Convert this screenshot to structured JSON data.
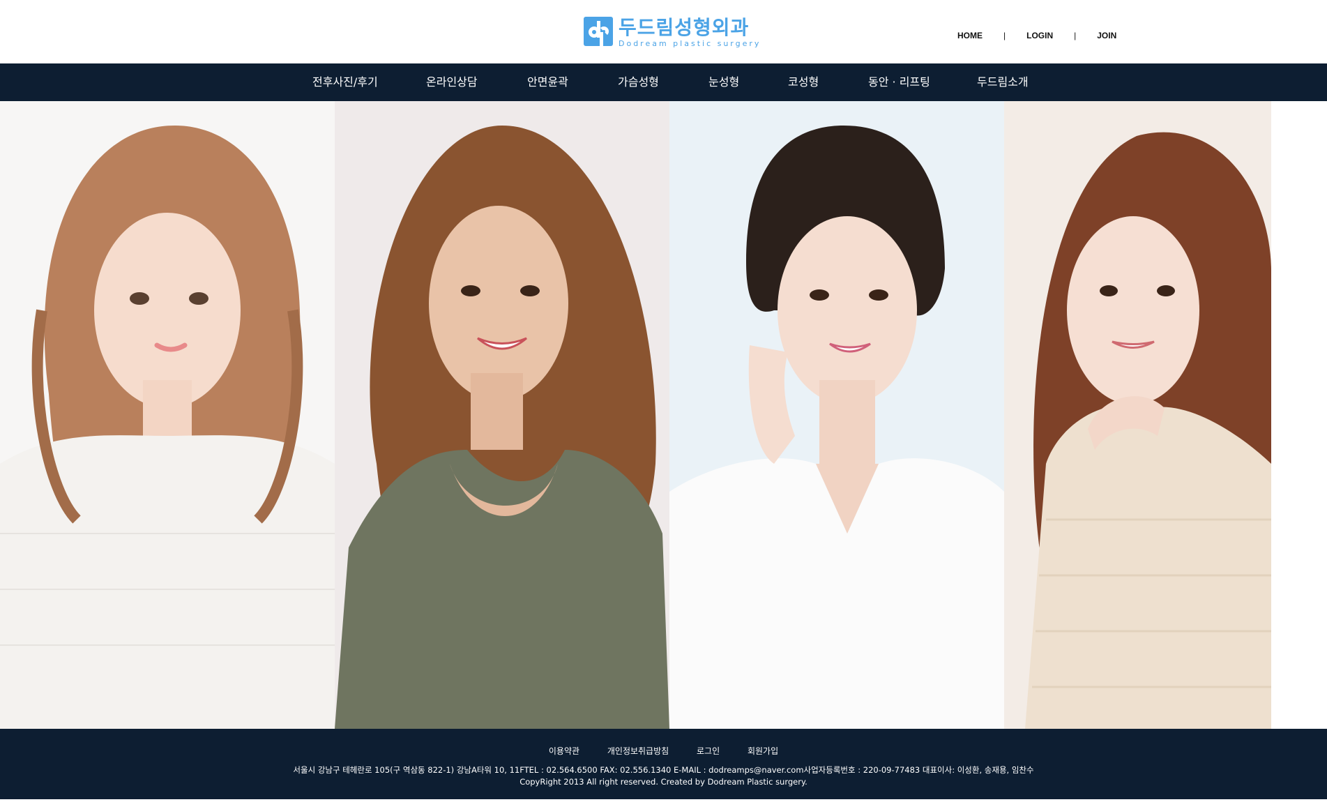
{
  "header": {
    "logo_ko": "두드림성형외과",
    "logo_en": "Dodream plastic surgery",
    "links": {
      "home": "HOME",
      "sep1": "|",
      "login": "LOGIN",
      "sep2": "|",
      "join": "JOIN"
    }
  },
  "nav": {
    "items": [
      {
        "label": "전후사진/후기"
      },
      {
        "label": "온라인상담"
      },
      {
        "label": "안면윤곽"
      },
      {
        "label": "가슴성형"
      },
      {
        "label": "눈성형"
      },
      {
        "label": "코성형"
      },
      {
        "label": "동안 · 리프팅"
      },
      {
        "label": "두드림소개"
      }
    ]
  },
  "hero": {
    "panels": [
      {
        "bg": "#f6f6f6",
        "hair": "#b9805c",
        "top": "#f4f2ef",
        "skin": "#f6dccd"
      },
      {
        "bg": "#efeaea",
        "hair": "#8a5430",
        "top": "#6f7560",
        "skin": "#e9c3a8"
      },
      {
        "bg": "#eaf2f7",
        "hair": "#2b201b",
        "top": "#fbfbfb",
        "skin": "#f5ddd0"
      },
      {
        "bg": "#f3ece6",
        "hair": "#7e4128",
        "top": "#eee0cf",
        "skin": "#f6dfd3"
      }
    ]
  },
  "footer": {
    "links": {
      "terms": "이용약관",
      "privacy": "개인정보취급방침",
      "login": "로그인",
      "join": "회원가입"
    },
    "address": "서울시 강남구 테헤란로 105(구 역삼동 822-1) 강남A타워 10, 11FTEL : 02.564.6500   FAX: 02.556.1340   E-MAIL : dodreamps@naver.com사업자등록번호 : 220-09-77483  대표이사: 이성환, 송재용, 임찬수",
    "copyright": "CopyRight 2013 All right reserved.  Created by Dodream Plastic surgery."
  },
  "colors": {
    "brand": "#4ba3e6",
    "nav_bg": "#0d1e32",
    "footer_bg": "#0d1e32"
  }
}
